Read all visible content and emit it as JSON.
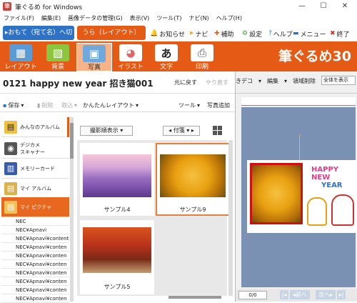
{
  "window": {
    "title": "筆ぐるめ for Windows",
    "icon": "筆"
  },
  "menu": [
    "ファイル(F)",
    "編集(E)",
    "画像データの管理(G)",
    "表示(V)",
    "ツール(T)",
    "ナビ(N)",
    "ヘルプ(H)"
  ],
  "modes": {
    "address": "▸おもて（宛て名）へ切替",
    "layout": "うら（レイアウト）"
  },
  "top_commands": [
    {
      "icon": "bell-icon",
      "label": "お知らせ"
    },
    {
      "icon": "navi-icon",
      "label": "ナビ"
    },
    {
      "icon": "cross-icon",
      "label": "補助"
    },
    {
      "icon": "gear-icon",
      "label": "設定"
    },
    {
      "icon": "question-icon",
      "label": "ヘルプ"
    },
    {
      "icon": "menu-icon",
      "label": "メニュー"
    },
    {
      "icon": "close-icon",
      "label": "終了"
    }
  ],
  "ribbon_tabs": [
    {
      "label": "レイアウト",
      "glyph": "▦",
      "color": "#5b9bd5"
    },
    {
      "label": "背景",
      "glyph": "▧",
      "color": "#8cc63f"
    },
    {
      "label": "写真",
      "glyph": "▣",
      "color": "#6fa8dc"
    },
    {
      "label": "イラスト",
      "glyph": "◕",
      "color": "#e06666"
    },
    {
      "label": "文字",
      "glyph": "あ",
      "color": "#ffffff"
    },
    {
      "label": "印刷",
      "glyph": "⎙",
      "color": "#ffffff"
    }
  ],
  "active_ribbon_tab": "写真",
  "brand": "筆ぐるめ30",
  "doc_title": "0121  happy new year  招き猫001",
  "undo": "元に戻す",
  "redo": "やり直す",
  "toolbar": {
    "save": "保存",
    "delete": "削除",
    "import": "取込",
    "easy_layout": "かんたんレイアウト",
    "tools": "ツール",
    "add_photo": "写真追加"
  },
  "sidebar": [
    {
      "label": "みんなのアルバム",
      "icon": "album-icon"
    },
    {
      "label": "デジカメ\nスキャナー",
      "icon": "camera-icon"
    },
    {
      "label": "メモリーカード",
      "icon": "memory-card-icon"
    },
    {
      "label": "マイ アルバム",
      "icon": "my-album-icon"
    },
    {
      "label": "マイ ピクチャ",
      "icon": "my-pictures-icon"
    }
  ],
  "selected_sidebar": "マイ ピクチャ",
  "tree": [
    "NEC",
    "NEC¥Apnavi",
    "NEC¥Apnavi¥contents",
    "NEC¥Apnavi¥conten",
    "NEC¥Apnavi¥conten",
    "NEC¥Apnavi¥conten",
    "NEC¥Apnavi¥conten",
    "NEC¥Apnavi¥conten",
    "NEC¥Apnavi¥conten",
    "NEC¥Apnavi¥conten"
  ],
  "list_view": {
    "sort": "撮影順表示",
    "attach": "付箋"
  },
  "photos": [
    {
      "label": "サンプル4"
    },
    {
      "label": "サンプル9"
    },
    {
      "label": "サンプル5"
    }
  ],
  "right_toolbar": {
    "decor": "きデコ",
    "edit": "編集",
    "area_delete": "領域削除",
    "zoom": "全体を表示"
  },
  "card_text": {
    "line1": "HAPPY NEW",
    "line2": "YEAR"
  },
  "page_counter": "0/0",
  "prev": "前へ",
  "next": "次へ"
}
